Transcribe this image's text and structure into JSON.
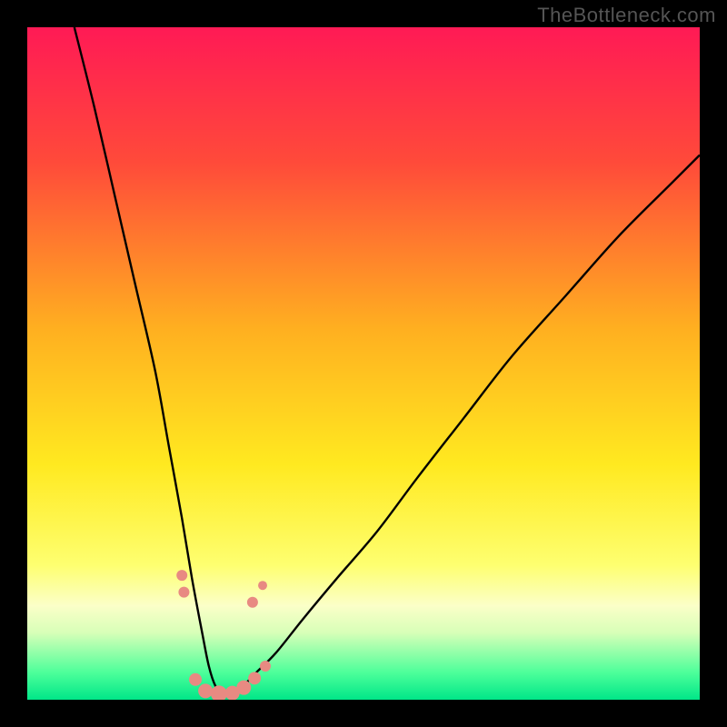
{
  "watermark": "TheBottleneck.com",
  "chart_data": {
    "type": "line",
    "title": "",
    "xlabel": "",
    "ylabel": "",
    "xlim": [
      0,
      100
    ],
    "ylim": [
      0,
      100
    ],
    "gradient_stops": [
      {
        "offset": 0,
        "color": "#ff1a55"
      },
      {
        "offset": 20,
        "color": "#ff4a3a"
      },
      {
        "offset": 45,
        "color": "#ffb020"
      },
      {
        "offset": 65,
        "color": "#ffe920"
      },
      {
        "offset": 80,
        "color": "#feff70"
      },
      {
        "offset": 86,
        "color": "#fbffc8"
      },
      {
        "offset": 90,
        "color": "#d8ffb8"
      },
      {
        "offset": 96,
        "color": "#4cff9a"
      },
      {
        "offset": 100,
        "color": "#00e688"
      }
    ],
    "series": [
      {
        "name": "bottleneck-curve",
        "x": [
          7,
          10,
          13,
          16,
          19,
          21,
          23,
          24.5,
          26,
          27,
          28,
          29,
          30,
          32,
          34,
          37,
          41,
          46,
          52,
          58,
          65,
          72,
          80,
          88,
          96,
          100
        ],
        "y": [
          100,
          88,
          75,
          62,
          49,
          38,
          27,
          18,
          10,
          5,
          2,
          1,
          1,
          2,
          4,
          7,
          12,
          18,
          25,
          33,
          42,
          51,
          60,
          69,
          77,
          81
        ]
      }
    ],
    "markers": {
      "name": "highlight-points",
      "color": "#e88a82",
      "points": [
        {
          "x": 23.0,
          "y": 18.5,
          "r": 6
        },
        {
          "x": 23.3,
          "y": 16.0,
          "r": 6
        },
        {
          "x": 25.0,
          "y": 3.0,
          "r": 7
        },
        {
          "x": 26.5,
          "y": 1.3,
          "r": 8
        },
        {
          "x": 28.5,
          "y": 0.9,
          "r": 9
        },
        {
          "x": 30.5,
          "y": 1.0,
          "r": 8
        },
        {
          "x": 32.2,
          "y": 1.8,
          "r": 8
        },
        {
          "x": 33.8,
          "y": 3.2,
          "r": 7
        },
        {
          "x": 35.4,
          "y": 5.0,
          "r": 6
        },
        {
          "x": 33.5,
          "y": 14.5,
          "r": 6
        },
        {
          "x": 35.0,
          "y": 17.0,
          "r": 5
        }
      ]
    }
  }
}
